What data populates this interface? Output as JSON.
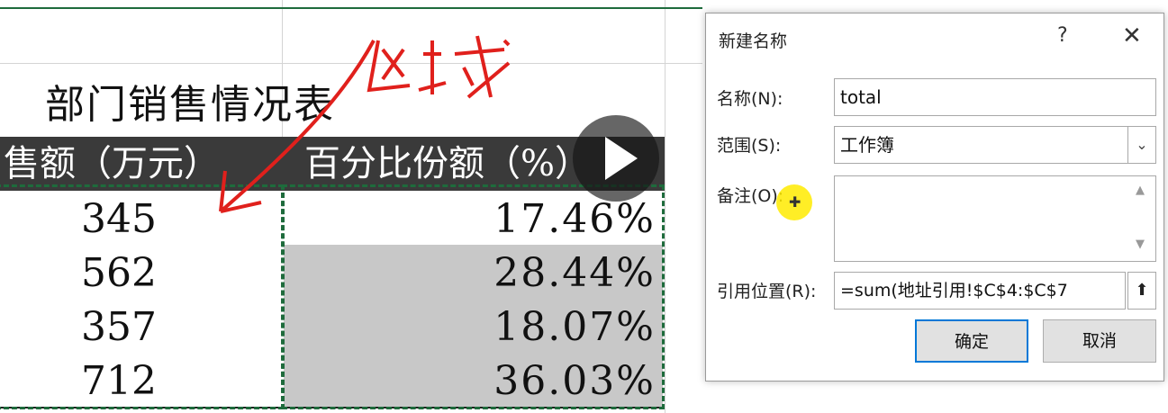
{
  "sheet": {
    "title": "部门销售情况表",
    "headers": [
      "售额（万元）",
      "百分比份额（%）"
    ],
    "rows": [
      {
        "amount": "345",
        "share": "17.46%"
      },
      {
        "amount": "562",
        "share": "28.44%"
      },
      {
        "amount": "357",
        "share": "18.07%"
      },
      {
        "amount": "712",
        "share": "36.03%"
      }
    ],
    "annotation_text": "区域"
  },
  "dialog": {
    "title": "新建名称",
    "help": "?",
    "close": "✕",
    "name_label": "名称(N):",
    "name_value": "total",
    "scope_label": "范围(S):",
    "scope_value": "工作簿",
    "comment_label": "备注(O):",
    "comment_value": "",
    "ref_label": "引用位置(R):",
    "ref_value": "=sum(地址引用!$C$4:$C$7",
    "ok_label": "确定",
    "cancel_label": "取消"
  },
  "colors": {
    "header_bg": "#3a3a3a",
    "selection_border": "#1e6b3c",
    "annotation_red": "#e0201c",
    "ok_border": "#0078d7"
  }
}
